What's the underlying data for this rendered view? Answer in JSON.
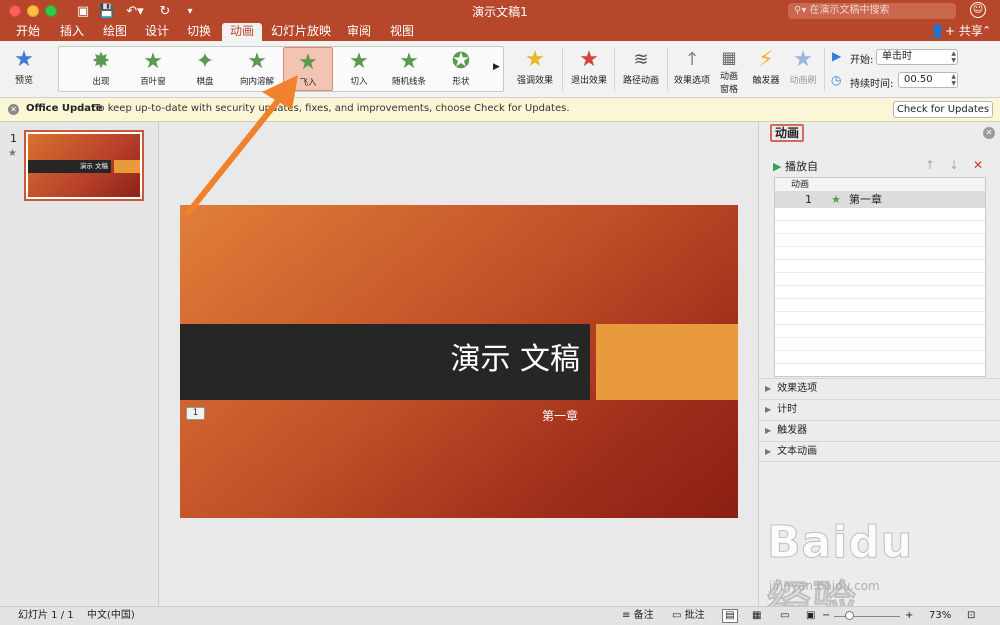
{
  "window": {
    "title": "演示文稿1",
    "search_placeholder": "在演示文稿中搜索",
    "share_label": "共享"
  },
  "tabs": [
    "开始",
    "插入",
    "绘图",
    "设计",
    "切换",
    "动画",
    "幻灯片放映",
    "审阅",
    "视图"
  ],
  "active_tab": "动画",
  "ribbon": {
    "preview_label": "预览",
    "gallery": [
      "出现",
      "百叶窗",
      "棋盘",
      "向内溶解",
      "飞入",
      "切入",
      "随机线条",
      "形状"
    ],
    "selected_effect": "飞入",
    "emphasis_label": "强调效果",
    "exit_label": "退出效果",
    "path_label": "路径动画",
    "effect_options_label": "效果选项",
    "anim_pane_label_line1": "动画",
    "anim_pane_label_line2": "窗格",
    "trigger_label": "触发器",
    "painter_label": "动画刷",
    "start_label": "开始:",
    "start_value": "单击时",
    "duration_label": "持续时间:",
    "duration_value": "00.50"
  },
  "message_bar": {
    "title": "Office Update",
    "text": "To keep up-to-date with security updates, fixes, and improvements, choose Check for Updates.",
    "button": "Check for Updates"
  },
  "thumbnails": {
    "number": "1",
    "title": "演示 文稿"
  },
  "slide": {
    "title": "演示 文稿",
    "subtitle": "第一章",
    "anim_tag": "1"
  },
  "animation_pane": {
    "title": "动画",
    "play_label": "播放自",
    "list_header": "动画",
    "items": [
      {
        "index": "1",
        "name": "第一章"
      }
    ],
    "sections": [
      "效果选项",
      "计时",
      "触发器",
      "文本动画"
    ]
  },
  "status_bar": {
    "slide_info": "幻灯片 1 / 1",
    "language": "中文(中国)",
    "notes": "备注",
    "comments": "批注",
    "zoom": "73%"
  },
  "watermark": {
    "logo": "Baidu经验",
    "url": "jingyan.baidu.com"
  },
  "colors": {
    "accent": "#b7472a",
    "arrow": "#f0812d",
    "selected_effect_bg": "#f3c4b4"
  }
}
